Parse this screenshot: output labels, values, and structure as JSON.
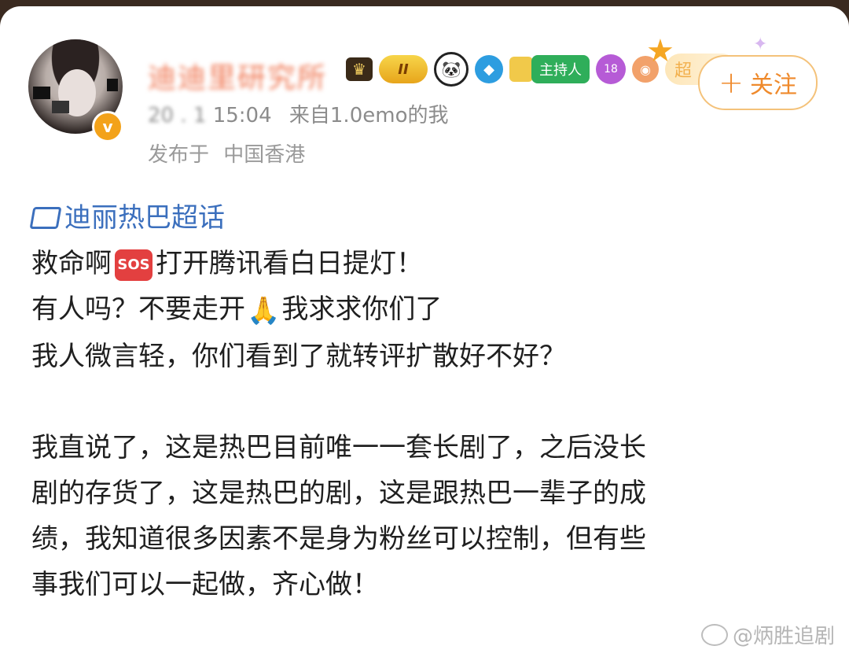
{
  "post": {
    "username": "迪迪里研究所",
    "timestamp_hidden": "20 . 1",
    "time": "15:04",
    "source": "来自1.0emo的我",
    "publish_prefix": "发布于",
    "location": "中国香港",
    "follow_label": "关注",
    "badges": {
      "level": "II",
      "host": "主持人",
      "gem": "18",
      "super": "超"
    },
    "topic": "迪丽热巴超话",
    "lines": [
      "救命啊",
      "打开腾讯看白日提灯！",
      "有人吗？不要走开",
      "我求求你们了",
      "我人微言轻，你们看到了就转评扩散好不好？"
    ],
    "emoji_sos": "SOS",
    "emoji_pray": "🙏",
    "paragraph": [
      "我直说了，这是热巴目前唯一一套长剧了，之后没长",
      "剧的存货了，这是热巴的剧，这是跟热巴一辈子的成",
      "绩，我知道很多因素不是身为粉丝可以控制，但有些",
      "事我们可以一起做，齐心做！"
    ]
  },
  "watermark": "@炳胜追剧",
  "colors": {
    "topic": "#3b6fbd",
    "follow": "#ef8a2c",
    "meta": "#8c8c8c"
  }
}
